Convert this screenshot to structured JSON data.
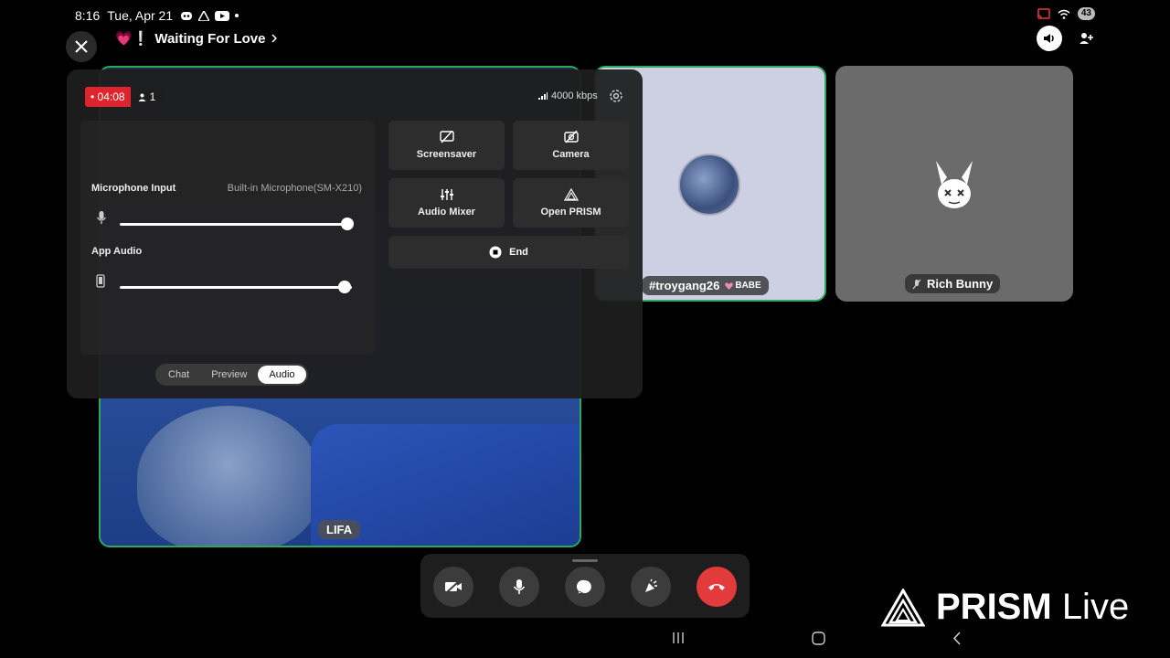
{
  "status_bar": {
    "time": "8:16",
    "date": "Tue, Apr 21",
    "battery": "43"
  },
  "header": {
    "channel_emoji": "💗❕",
    "channel_name": "Waiting For Love"
  },
  "tiles": {
    "main_name": "LIFA",
    "troy_name": "#troygang26",
    "troy_badge": "BABE",
    "bunny_name": "Rich Bunny"
  },
  "overlay": {
    "rec_time": "04:08",
    "viewers": "1",
    "bitrate": "4000 kbps",
    "mic_label": "Microphone Input",
    "mic_device": "Built-in Microphone(SM-X210)",
    "mic_level": 0.98,
    "app_audio_label": "App Audio",
    "app_audio_level": 0.97,
    "buttons": {
      "screensaver": "Screensaver",
      "camera": "Camera",
      "audio_mixer": "Audio Mixer",
      "open_prism": "Open PRISM",
      "end": "End"
    },
    "tabs": {
      "chat": "Chat",
      "preview": "Preview",
      "audio": "Audio",
      "active": "Audio"
    }
  },
  "branding": {
    "prism_bold": "PRISM",
    "prism_light": "Live"
  },
  "colors": {
    "speaking_border": "#2ea85a",
    "record_red": "#e0242e",
    "hangup_red": "#e33b3b"
  }
}
